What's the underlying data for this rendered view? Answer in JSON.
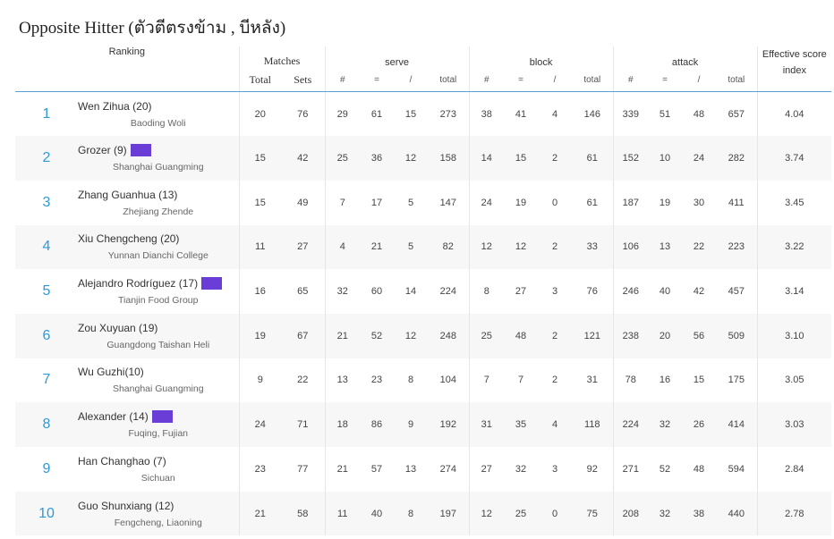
{
  "title": "Opposite Hitter (ตัวตีตรงข้าม , บีหลัง)",
  "headers": {
    "ranking": "Ranking",
    "matches": "Matches",
    "matches_total": "Total",
    "matches_sets": "Sets",
    "serve": "serve",
    "block": "block",
    "attack": "attack",
    "sub": [
      "#",
      "=",
      "/",
      "total"
    ],
    "effective_line1": "Effective score",
    "effective_line2": "index"
  },
  "rows": [
    {
      "rank": "1",
      "name": "Wen Zihua (20)",
      "team": "Baoding Woli",
      "flag": false,
      "total": "20",
      "sets": "76",
      "serve": [
        "29",
        "61",
        "15",
        "273"
      ],
      "block": [
        "38",
        "41",
        "4",
        "146"
      ],
      "attack": [
        "339",
        "51",
        "48",
        "657"
      ],
      "eff": "4.04"
    },
    {
      "rank": "2",
      "name": "Grozer (9)",
      "team": "Shanghai Guangming",
      "flag": true,
      "total": "15",
      "sets": "42",
      "serve": [
        "25",
        "36",
        "12",
        "158"
      ],
      "block": [
        "14",
        "15",
        "2",
        "61"
      ],
      "attack": [
        "152",
        "10",
        "24",
        "282"
      ],
      "eff": "3.74"
    },
    {
      "rank": "3",
      "name": "Zhang Guanhua (13)",
      "team": "Zhejiang Zhende",
      "flag": false,
      "total": "15",
      "sets": "49",
      "serve": [
        "7",
        "17",
        "5",
        "147"
      ],
      "block": [
        "24",
        "19",
        "0",
        "61"
      ],
      "attack": [
        "187",
        "19",
        "30",
        "411"
      ],
      "eff": "3.45"
    },
    {
      "rank": "4",
      "name": "Xiu Chengcheng (20)",
      "team": "Yunnan Dianchi College",
      "flag": false,
      "total": "11",
      "sets": "27",
      "serve": [
        "4",
        "21",
        "5",
        "82"
      ],
      "block": [
        "12",
        "12",
        "2",
        "33"
      ],
      "attack": [
        "106",
        "13",
        "22",
        "223"
      ],
      "eff": "3.22"
    },
    {
      "rank": "5",
      "name": "Alejandro Rodríguez (17)",
      "team": "Tianjin Food Group",
      "flag": true,
      "total": "16",
      "sets": "65",
      "serve": [
        "32",
        "60",
        "14",
        "224"
      ],
      "block": [
        "8",
        "27",
        "3",
        "76"
      ],
      "attack": [
        "246",
        "40",
        "42",
        "457"
      ],
      "eff": "3.14"
    },
    {
      "rank": "6",
      "name": "Zou Xuyuan (19)",
      "team": "Guangdong Taishan Heli",
      "flag": false,
      "total": "19",
      "sets": "67",
      "serve": [
        "21",
        "52",
        "12",
        "248"
      ],
      "block": [
        "25",
        "48",
        "2",
        "121"
      ],
      "attack": [
        "238",
        "20",
        "56",
        "509"
      ],
      "eff": "3.10"
    },
    {
      "rank": "7",
      "name": "Wu Guzhi(10)",
      "team": "Shanghai Guangming",
      "flag": false,
      "total": "9",
      "sets": "22",
      "serve": [
        "13",
        "23",
        "8",
        "104"
      ],
      "block": [
        "7",
        "7",
        "2",
        "31"
      ],
      "attack": [
        "78",
        "16",
        "15",
        "175"
      ],
      "eff": "3.05"
    },
    {
      "rank": "8",
      "name": "Alexander (14)",
      "team": "Fuqing, Fujian",
      "flag": true,
      "total": "24",
      "sets": "71",
      "serve": [
        "18",
        "86",
        "9",
        "192"
      ],
      "block": [
        "31",
        "35",
        "4",
        "118"
      ],
      "attack": [
        "224",
        "32",
        "26",
        "414"
      ],
      "eff": "3.03"
    },
    {
      "rank": "9",
      "name": "Han Changhao (7)",
      "team": "Sichuan",
      "flag": false,
      "total": "23",
      "sets": "77",
      "serve": [
        "21",
        "57",
        "13",
        "274"
      ],
      "block": [
        "27",
        "32",
        "3",
        "92"
      ],
      "attack": [
        "271",
        "52",
        "48",
        "594"
      ],
      "eff": "2.84"
    },
    {
      "rank": "10",
      "name": "Guo Shunxiang (12)",
      "team": "Fengcheng, Liaoning",
      "flag": false,
      "total": "21",
      "sets": "58",
      "serve": [
        "11",
        "40",
        "8",
        "197"
      ],
      "block": [
        "12",
        "25",
        "0",
        "75"
      ],
      "attack": [
        "208",
        "32",
        "38",
        "440"
      ],
      "eff": "2.78"
    }
  ]
}
